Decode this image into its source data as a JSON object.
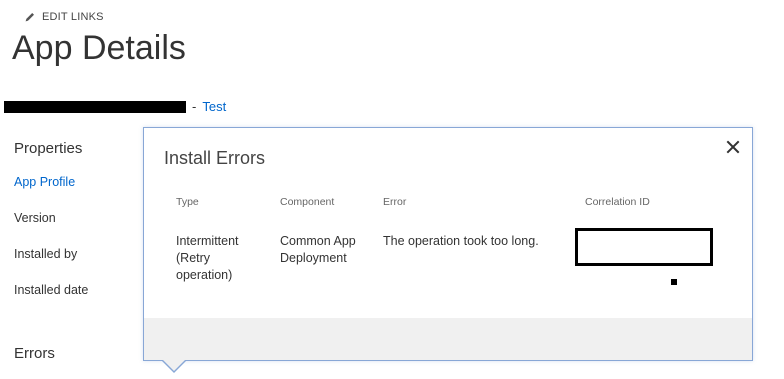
{
  "header": {
    "edit_links_label": "EDIT LINKS",
    "page_title": "App Details"
  },
  "breadcrumb": {
    "separator": "-",
    "link_label": "Test"
  },
  "left_nav": {
    "section_title": "Properties",
    "items": [
      {
        "label": "App Profile",
        "active": true
      },
      {
        "label": "Version",
        "active": false
      },
      {
        "label": "Installed by",
        "active": false
      },
      {
        "label": "Installed date",
        "active": false
      }
    ],
    "errors_title": "Errors"
  },
  "dialog": {
    "title": "Install Errors",
    "close_icon": "close-icon",
    "table": {
      "headers": [
        "Type",
        "Component",
        "Error",
        "Correlation ID"
      ],
      "rows": [
        {
          "type": "Intermittent (Retry operation)",
          "component": "Common App Deployment",
          "error": "The operation took too long.",
          "correlation_id": ""
        }
      ]
    }
  },
  "colors": {
    "link": "#0066cc",
    "dialog_border": "#88a7d6",
    "footer_bg": "#f0f0f0",
    "text": "#333333"
  }
}
